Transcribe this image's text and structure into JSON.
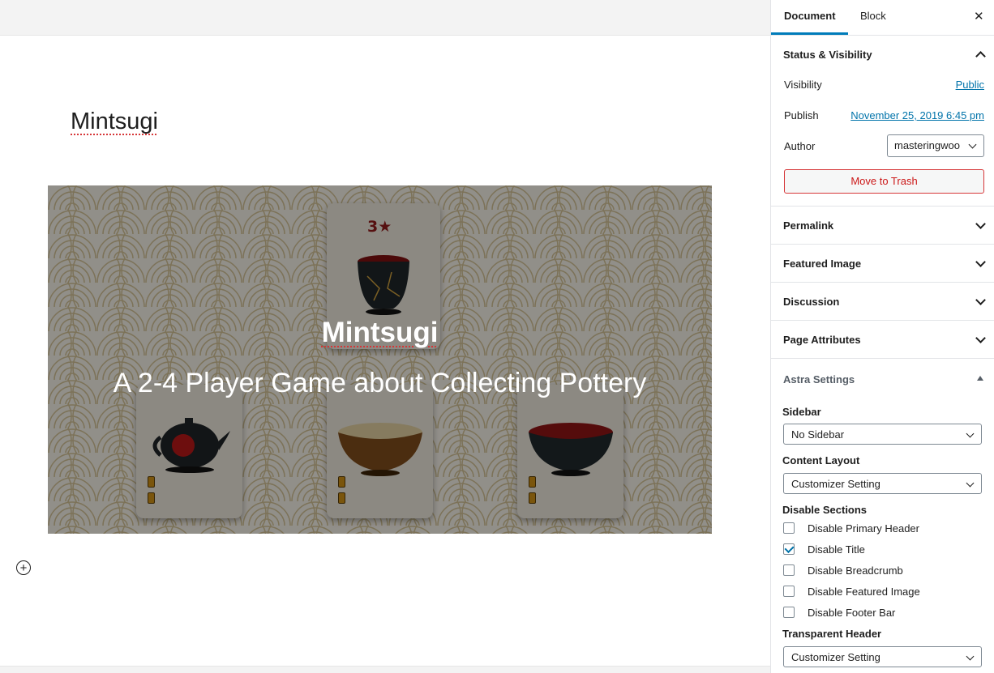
{
  "editor": {
    "post_title": "Mintsugi",
    "cover": {
      "card_top_mark": "3★",
      "title": "Mintsugi",
      "subtitle": "A 2-4 Player Game about Collecting Pottery"
    },
    "add_block_glyph": "+"
  },
  "sidebar": {
    "tabs": {
      "document": "Document",
      "block": "Block"
    },
    "close_glyph": "✕",
    "status": {
      "heading": "Status & Visibility",
      "visibility_label": "Visibility",
      "visibility_value": "Public",
      "publish_label": "Publish",
      "publish_value": "November 25, 2019 6:45 pm",
      "author_label": "Author",
      "author_value": "masteringwoo",
      "trash_label": "Move to Trash"
    },
    "panels": {
      "permalink": "Permalink",
      "featured_image": "Featured Image",
      "discussion": "Discussion",
      "page_attributes": "Page Attributes"
    },
    "astra": {
      "heading": "Astra Settings",
      "sidebar_label": "Sidebar",
      "sidebar_value": "No Sidebar",
      "content_layout_label": "Content Layout",
      "content_layout_value": "Customizer Setting",
      "disable_sections_label": "Disable Sections",
      "checkboxes": [
        {
          "label": "Disable Primary Header",
          "checked": false
        },
        {
          "label": "Disable Title",
          "checked": true
        },
        {
          "label": "Disable Breadcrumb",
          "checked": false
        },
        {
          "label": "Disable Featured Image",
          "checked": false
        },
        {
          "label": "Disable Footer Bar",
          "checked": false
        }
      ],
      "transparent_header_label": "Transparent Header",
      "transparent_header_value": "Customizer Setting"
    }
  },
  "colors": {
    "accent": "#007cba",
    "link": "#0073aa",
    "danger": "#d63638"
  }
}
